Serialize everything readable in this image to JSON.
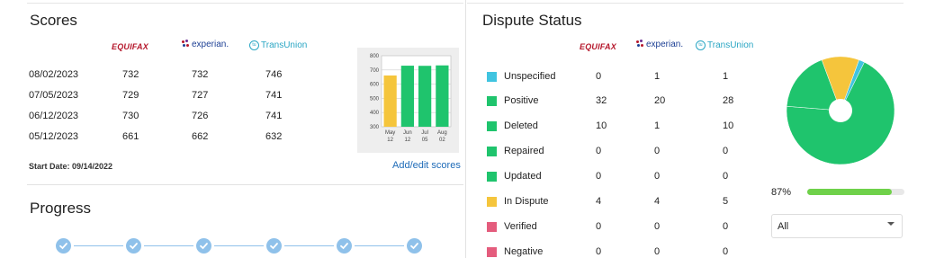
{
  "scores": {
    "title": "Scores",
    "bureaus": [
      "EQUIFAX",
      "experian.",
      "TransUnion"
    ],
    "rows": [
      {
        "date": "08/02/2023",
        "values": [
          "732",
          "732",
          "746"
        ]
      },
      {
        "date": "07/05/2023",
        "values": [
          "729",
          "727",
          "741"
        ]
      },
      {
        "date": "06/12/2023",
        "values": [
          "730",
          "726",
          "741"
        ]
      },
      {
        "date": "05/12/2023",
        "values": [
          "661",
          "662",
          "632"
        ]
      }
    ],
    "start_date": "Start Date: 09/14/2022",
    "add_edit_link": "Add/edit scores"
  },
  "mini_chart": {
    "y_ticks": [
      "800",
      "700",
      "600",
      "500",
      "400",
      "300"
    ],
    "x_labels": [
      [
        "May",
        "12"
      ],
      [
        "Jun",
        "12"
      ],
      [
        "Jul",
        "05"
      ],
      [
        "Aug",
        "02"
      ]
    ]
  },
  "chart_data": [
    {
      "type": "bar",
      "categories": [
        "May 12",
        "Jun 12",
        "Jul 05",
        "Aug 02"
      ],
      "values": [
        661,
        730,
        729,
        732
      ],
      "ylim": [
        300,
        800
      ],
      "colors": [
        "#f5c53c",
        "#1fc46d",
        "#1fc46d",
        "#1fc46d"
      ],
      "grid": true
    },
    {
      "type": "pie",
      "categories": [
        "Unspecified",
        "Positive",
        "Deleted",
        "In Dispute"
      ],
      "values": [
        2,
        80,
        21,
        13
      ],
      "colors": [
        "#40c4e0",
        "#1fc46d",
        "#1fc46d",
        "#f5c53c"
      ],
      "donut": true
    }
  ],
  "progress": {
    "title": "Progress",
    "steps": 6
  },
  "dispute": {
    "title": "Dispute Status",
    "bureaus": [
      "EQUIFAX",
      "experian.",
      "TransUnion"
    ],
    "rows": [
      {
        "label": "Unspecified",
        "color": "#40c4e0",
        "values": [
          "0",
          "1",
          "1"
        ]
      },
      {
        "label": "Positive",
        "color": "#1fc46d",
        "values": [
          "32",
          "20",
          "28"
        ]
      },
      {
        "label": "Deleted",
        "color": "#1fc46d",
        "values": [
          "10",
          "1",
          "10"
        ]
      },
      {
        "label": "Repaired",
        "color": "#1fc46d",
        "values": [
          "0",
          "0",
          "0"
        ]
      },
      {
        "label": "Updated",
        "color": "#1fc46d",
        "values": [
          "0",
          "0",
          "0"
        ]
      },
      {
        "label": "In Dispute",
        "color": "#f5c53c",
        "values": [
          "4",
          "4",
          "5"
        ]
      },
      {
        "label": "Verified",
        "color": "#e45c7d",
        "values": [
          "0",
          "0",
          "0"
        ]
      },
      {
        "label": "Negative",
        "color": "#e45c7d",
        "values": [
          "0",
          "0",
          "0"
        ]
      }
    ],
    "percent_label": "87%",
    "percent_value": 0.87,
    "filter_value": "All"
  }
}
